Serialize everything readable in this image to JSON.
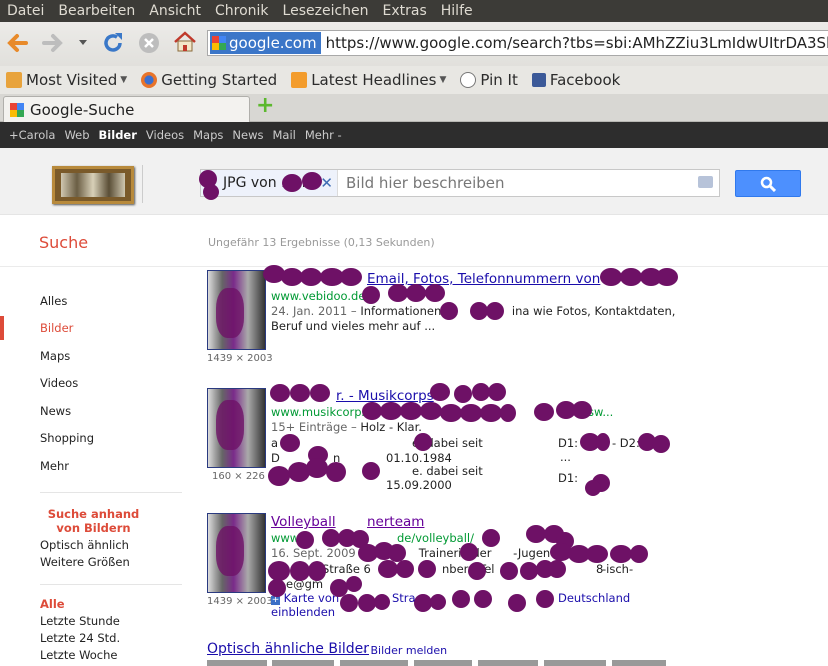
{
  "menu": [
    "Datei",
    "Bearbeiten",
    "Ansicht",
    "Chronik",
    "Lesezeichen",
    "Extras",
    "Hilfe"
  ],
  "url": {
    "site": "google.com",
    "address": "https://www.google.com/search?tbs=sbi:AMhZZiu3LmIdwUItrDA3SkgKS7c"
  },
  "bookmarks": [
    "Most Visited",
    "Getting Started",
    "Latest Headlines",
    "Pin It",
    "Facebook"
  ],
  "tab": {
    "title": "Google-Suche",
    "new": "+"
  },
  "gbar": [
    "+Carola",
    "Web",
    "Bilder",
    "Videos",
    "Maps",
    "News",
    "Mail",
    "Mehr -"
  ],
  "search": {
    "chip": "JPG von .com",
    "placeholder": "Bild hier beschreiben"
  },
  "suche": "Suche",
  "stats": "Ungefähr 13 Ergebnisse (0,13 Sekunden)",
  "side": {
    "items": [
      "Alles",
      "Bilder",
      "Maps",
      "Videos",
      "News",
      "Shopping",
      "Mehr"
    ],
    "heading": "Suche anhand von Bildern",
    "sub": [
      "Optisch ähnlich",
      "Weitere Größen"
    ],
    "timeHead": "Alle",
    "time": [
      "Letzte Stunde",
      "Letzte 24 Std.",
      "Letzte Woche"
    ]
  },
  "results": [
    {
      "title": "Email, Fotos, Telefonnummern von",
      "url": "www.vebidoo.de",
      "date": "24. Jan. 2011 –",
      "s1": "Informationen zu",
      "s1b": "ina wie Fotos, Kontaktdaten,",
      "s2": "Beruf und vieles mehr auf ...",
      "dim": "1439 × 2003"
    },
    {
      "title": "r. - Musikcorps",
      "url": "www.musikcorps",
      "url2": "sw...",
      "date": "15+ Einträge –",
      "s1": "Holz - Klar.",
      "c1a": "a",
      "c1b": "D",
      "c1c": "n",
      "c2a": "e. dabei seit",
      "c2b": "01.10.1984",
      "c2c": "e. dabei seit",
      "c2d": "15.09.2000",
      "c3a": "D1:",
      "c3b": "- D2:",
      "c3c": "...",
      "c3d": "D1:",
      "dim": "160 × 226"
    },
    {
      "title": "Volleyball",
      "title2": "nerteam",
      "url": "www",
      "url2": "de/volleyball/",
      "date": "16. Sept. 2009 –",
      "s1": "Trainerin der",
      "s1b": "-Jugend",
      "s2a": "Straße 6",
      "s2b": "nberg Tel",
      "s2c": "8",
      "s2d": "-isch-",
      "s3": "e@gm",
      "map": "Karte von",
      "map2": "Stra",
      "map3": "Deutschland",
      "map4": "einblenden",
      "dim": "1439 × 2003"
    }
  ],
  "similar": "Optisch ähnliche Bilder",
  "report": "- Bilder melden"
}
